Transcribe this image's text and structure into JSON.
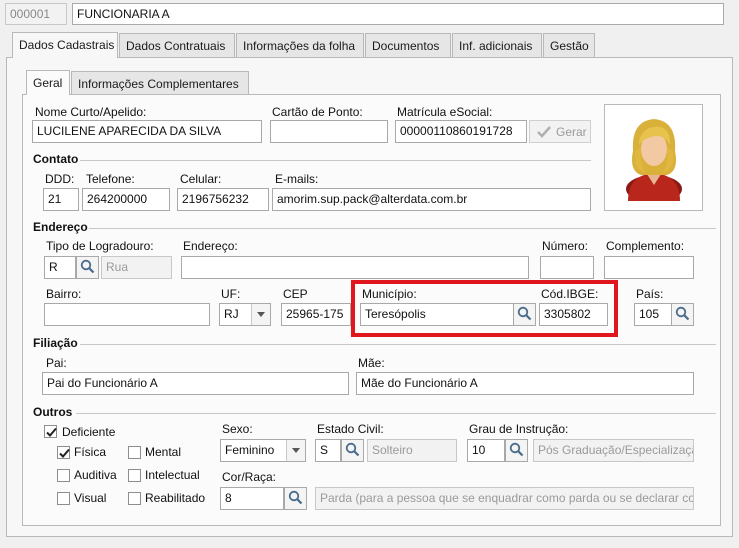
{
  "header": {
    "code": "000001",
    "name": "FUNCIONARIA A"
  },
  "tabs": [
    {
      "label": "Dados Cadastrais"
    },
    {
      "label": "Dados Contratuais"
    },
    {
      "label": "Informações da folha"
    },
    {
      "label": "Documentos"
    },
    {
      "label": "Inf. adicionais"
    },
    {
      "label": "Gestão"
    }
  ],
  "subtabs": [
    {
      "label": "Geral"
    },
    {
      "label": "Informações Complementares"
    }
  ],
  "general": {
    "nome_curto_label": "Nome Curto/Apelido:",
    "nome_curto": "LUCILENE APARECIDA DA SILVA",
    "cartao_label": "Cartão de Ponto:",
    "cartao": "",
    "matricula_label": "Matrícula eSocial:",
    "matricula": "00000110860191728",
    "gerar_label": "Gerar"
  },
  "contato": {
    "title": "Contato",
    "ddd_label": "DDD:",
    "ddd": "21",
    "telefone_label": "Telefone:",
    "telefone": "264200000",
    "celular_label": "Celular:",
    "celular": "2196756232",
    "emails_label": "E-mails:",
    "emails": "amorim.sup.pack@alterdata.com.br"
  },
  "endereco": {
    "title": "Endereço",
    "tipo_label": "Tipo de Logradouro:",
    "tipo_code": "R",
    "tipo_desc": "Rua",
    "endereco_label": "Endereço:",
    "endereco": "",
    "numero_label": "Número:",
    "numero": "",
    "complemento_label": "Complemento:",
    "complemento": "",
    "bairro_label": "Bairro:",
    "bairro": "",
    "uf_label": "UF:",
    "uf": "RJ",
    "cep_label": "CEP",
    "cep": "25965-175",
    "municipio_label": "Município:",
    "municipio": "Teresópolis",
    "ibge_label": "Cód.IBGE:",
    "ibge": "3305802",
    "pais_label": "País:",
    "pais": "105",
    "highlight_color": "#e0161e"
  },
  "filiacao": {
    "title": "Filiação",
    "pai_label": "Pai:",
    "pai": "Pai do Funcionário A",
    "mae_label": "Mãe:",
    "mae": "Mãe do Funcionário A"
  },
  "outros": {
    "title": "Outros",
    "deficiente": {
      "label": "Deficiente",
      "checked": true
    },
    "fisica": {
      "label": "Física",
      "checked": true
    },
    "mental": {
      "label": "Mental",
      "checked": false
    },
    "auditiva": {
      "label": "Auditiva",
      "checked": false
    },
    "intelectual": {
      "label": "Intelectual",
      "checked": false
    },
    "visual": {
      "label": "Visual",
      "checked": false
    },
    "reabilitado": {
      "label": "Reabilitado",
      "checked": false
    },
    "sexo_label": "Sexo:",
    "sexo": "Feminino",
    "estado_civil_label": "Estado Civil:",
    "estado_civil_code": "S",
    "estado_civil_desc": "Solteiro",
    "grau_label": "Grau de Instrução:",
    "grau_code": "10",
    "grau_desc": "Pós Graduação/Especialização",
    "cor_label": "Cor/Raça:",
    "cor_code": "8",
    "cor_desc": "Parda (para a pessoa que se enquadrar como parda ou se declarar como"
  },
  "icons": {
    "search": "search-icon",
    "check": "check-icon",
    "dropdown": "chevron-down-icon",
    "avatar": "avatar-woman-icon"
  }
}
